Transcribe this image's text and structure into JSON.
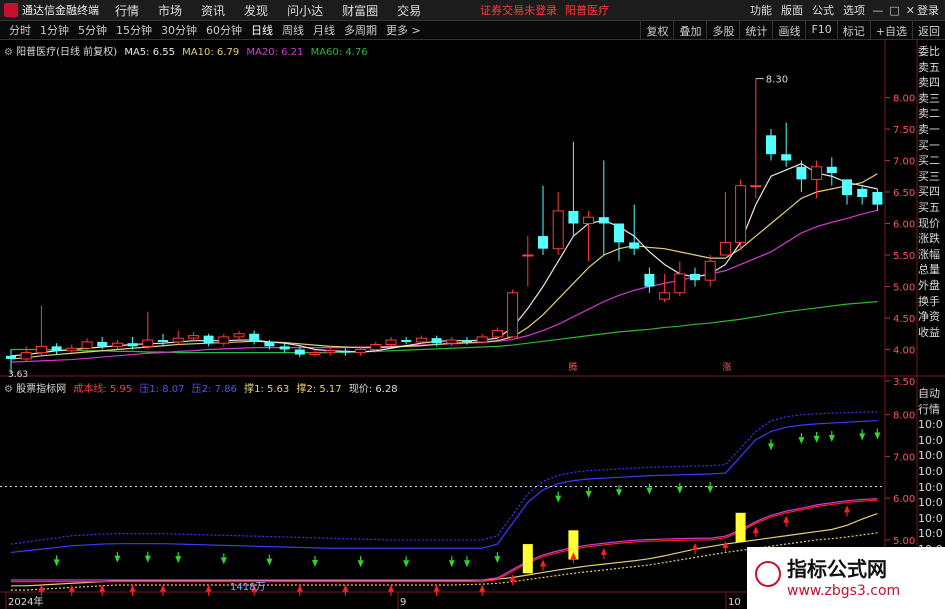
{
  "app": {
    "title": "通达信金融终端"
  },
  "menu": [
    "行情",
    "市场",
    "资讯",
    "发现",
    "问小达",
    "财富圈",
    "交易"
  ],
  "status": {
    "login_state": "证券交易未登录",
    "stock_name": "阳普医疗"
  },
  "right_links": [
    "功能",
    "版面",
    "公式",
    "选项"
  ],
  "login_label": "登录",
  "periods": [
    "分时",
    "1分钟",
    "5分钟",
    "15分钟",
    "30分钟",
    "60分钟",
    "日线",
    "周线",
    "月线",
    "多周期",
    "更多"
  ],
  "active_period": "日线",
  "tool_buttons": [
    "复权",
    "叠加",
    "多股",
    "统计",
    "画线",
    "F10",
    "标记",
    "+自选",
    "返回"
  ],
  "main_legend": {
    "title": "阳普医疗(日线 前复权)",
    "ma5": "MA5: 6.55",
    "ma10": "MA10: 6.79",
    "ma20": "MA20: 6.21",
    "ma60": "MA60: 4.76"
  },
  "ind_legend": {
    "title": "股票指标网",
    "cost": "成本线: 5.95",
    "z1": "压1: 8.07",
    "z2": "压2: 7.86",
    "s1": "撑1: 5.63",
    "s2": "撑2: 5.17",
    "price": "现价: 6.28"
  },
  "price_axis_top": [
    "8.00",
    "7.50",
    "7.00",
    "6.50",
    "6.00",
    "5.50",
    "5.00",
    "4.50",
    "4.00",
    "3.50"
  ],
  "price_axis_bottom": [
    "8.00",
    "7.00",
    "6.00",
    "5.00"
  ],
  "right_panel_top": [
    "委比",
    "卖五",
    "卖四",
    "卖三",
    "卖二",
    "卖一",
    "买一",
    "买二",
    "买三",
    "买四",
    "买五",
    "现价",
    "涨跌",
    "涨幅",
    "总量",
    "外盘",
    "换手",
    "净资",
    "收益"
  ],
  "right_panel_bottom": [
    "自动",
    "行情",
    "10:0",
    "10:0",
    "10:0",
    "10:0",
    "10:0",
    "10:0",
    "10:0",
    "10:0",
    "10:0",
    "10:0"
  ],
  "annotations": {
    "high": "8.30",
    "low": "3.63",
    "marker_a": "腾",
    "marker_b": "涨",
    "volume": "1418万"
  },
  "date_axis": [
    "2024年",
    "9",
    "10"
  ],
  "watermark": {
    "line1": "指标公式网",
    "line2": "www.zbgs3.com"
  },
  "colors": {
    "up": "#ff3b3b",
    "down": "#54ffff",
    "ma5": "#e8e8e8",
    "ma10": "#e6d07a",
    "ma20": "#d23ad2",
    "ma60": "#2fb82f",
    "cost": "#ff2020",
    "press1": "#3a3aff",
    "support": "#e6d07a",
    "bar": "#ffff33"
  },
  "chart_data": {
    "type": "candlestick",
    "candles": [
      [
        3.9,
        3.85,
        4.0,
        3.63
      ],
      [
        3.85,
        3.95,
        4.05,
        3.8
      ],
      [
        3.95,
        4.05,
        4.7,
        3.9
      ],
      [
        4.05,
        3.98,
        4.1,
        3.92
      ],
      [
        3.98,
        4.02,
        4.08,
        3.94
      ],
      [
        4.02,
        4.12,
        4.18,
        3.98
      ],
      [
        4.12,
        4.05,
        4.2,
        4.0
      ],
      [
        4.05,
        4.1,
        4.15,
        4.0
      ],
      [
        4.1,
        4.05,
        4.2,
        4.0
      ],
      [
        4.05,
        4.15,
        4.6,
        4.0
      ],
      [
        4.15,
        4.12,
        4.25,
        4.05
      ],
      [
        4.12,
        4.18,
        4.3,
        4.08
      ],
      [
        4.18,
        4.22,
        4.28,
        4.12
      ],
      [
        4.22,
        4.1,
        4.25,
        4.05
      ],
      [
        4.1,
        4.2,
        4.25,
        4.05
      ],
      [
        4.2,
        4.25,
        4.3,
        4.15
      ],
      [
        4.25,
        4.12,
        4.3,
        4.08
      ],
      [
        4.12,
        4.05,
        4.15,
        4.0
      ],
      [
        4.05,
        4.0,
        4.1,
        3.95
      ],
      [
        4.0,
        3.92,
        4.05,
        3.88
      ],
      [
        3.92,
        3.95,
        4.0,
        3.88
      ],
      [
        3.95,
        3.98,
        4.05,
        3.9
      ],
      [
        3.98,
        3.95,
        4.02,
        3.9
      ],
      [
        3.95,
        4.0,
        4.05,
        3.9
      ],
      [
        4.0,
        4.08,
        4.12,
        3.95
      ],
      [
        4.08,
        4.15,
        4.2,
        4.05
      ],
      [
        4.15,
        4.12,
        4.2,
        4.08
      ],
      [
        4.12,
        4.18,
        4.22,
        4.1
      ],
      [
        4.18,
        4.1,
        4.22,
        4.05
      ],
      [
        4.1,
        4.15,
        4.2,
        4.05
      ],
      [
        4.15,
        4.12,
        4.2,
        4.08
      ],
      [
        4.12,
        4.2,
        4.25,
        4.1
      ],
      [
        4.2,
        4.3,
        4.35,
        4.15
      ],
      [
        4.2,
        4.9,
        4.95,
        4.2
      ],
      [
        5.5,
        5.5,
        5.8,
        5.0
      ],
      [
        5.8,
        5.6,
        6.6,
        5.5
      ],
      [
        5.6,
        6.2,
        6.5,
        5.5
      ],
      [
        6.2,
        6.0,
        7.3,
        5.8
      ],
      [
        6.0,
        6.1,
        6.2,
        5.4
      ],
      [
        6.1,
        6.0,
        7.0,
        5.5
      ],
      [
        6.0,
        5.7,
        5.9,
        5.4
      ],
      [
        5.7,
        5.6,
        6.3,
        5.5
      ],
      [
        5.2,
        5.0,
        5.3,
        4.9
      ],
      [
        4.8,
        4.9,
        5.2,
        4.75
      ],
      [
        4.9,
        5.2,
        5.4,
        4.85
      ],
      [
        5.2,
        5.1,
        5.3,
        5.0
      ],
      [
        5.1,
        5.4,
        5.5,
        5.0
      ],
      [
        5.5,
        5.7,
        6.5,
        5.5
      ],
      [
        5.7,
        6.6,
        6.7,
        5.6
      ],
      [
        6.6,
        6.6,
        8.3,
        6.4
      ],
      [
        7.4,
        7.1,
        7.5,
        7.0
      ],
      [
        7.1,
        7.0,
        7.6,
        6.9
      ],
      [
        6.9,
        6.7,
        7.0,
        6.5
      ],
      [
        6.7,
        6.9,
        7.0,
        6.4
      ],
      [
        6.9,
        6.8,
        7.05,
        6.6
      ],
      [
        6.7,
        6.45,
        6.6,
        6.3
      ],
      [
        6.55,
        6.42,
        6.6,
        6.3
      ],
      [
        6.5,
        6.3,
        6.55,
        6.2
      ]
    ],
    "ma5": [
      3.9,
      3.92,
      3.95,
      3.98,
      4.0,
      4.02,
      4.04,
      4.06,
      4.08,
      4.09,
      4.1,
      4.12,
      4.14,
      4.14,
      4.14,
      4.15,
      4.15,
      4.12,
      4.1,
      4.06,
      4.0,
      3.98,
      3.97,
      3.96,
      3.98,
      4.02,
      4.06,
      4.1,
      4.13,
      4.14,
      4.14,
      4.15,
      4.18,
      4.35,
      4.65,
      5.0,
      5.4,
      5.8,
      6.0,
      6.05,
      5.95,
      5.8,
      5.55,
      5.35,
      5.2,
      5.15,
      5.2,
      5.35,
      5.7,
      6.3,
      6.75,
      6.85,
      6.95,
      6.8,
      6.75,
      6.65,
      6.6,
      6.55
    ],
    "ma10": [
      3.85,
      3.87,
      3.9,
      3.92,
      3.94,
      3.96,
      3.98,
      4.0,
      4.02,
      4.04,
      4.06,
      4.08,
      4.09,
      4.1,
      4.11,
      4.12,
      4.13,
      4.12,
      4.11,
      4.09,
      4.07,
      4.05,
      4.04,
      4.03,
      4.03,
      4.04,
      4.05,
      4.06,
      4.08,
      4.1,
      4.11,
      4.12,
      4.14,
      4.2,
      4.35,
      4.55,
      4.8,
      5.05,
      5.3,
      5.5,
      5.6,
      5.65,
      5.62,
      5.6,
      5.55,
      5.5,
      5.45,
      5.45,
      5.6,
      5.8,
      6.0,
      6.2,
      6.4,
      6.5,
      6.55,
      6.6,
      6.65,
      6.79
    ],
    "ma20": [
      3.8,
      3.81,
      3.82,
      3.83,
      3.84,
      3.86,
      3.88,
      3.9,
      3.92,
      3.94,
      3.95,
      3.97,
      3.98,
      4.0,
      4.01,
      4.02,
      4.03,
      4.03,
      4.03,
      4.03,
      4.03,
      4.03,
      4.03,
      4.04,
      4.04,
      4.05,
      4.06,
      4.07,
      4.08,
      4.09,
      4.1,
      4.11,
      4.13,
      4.16,
      4.22,
      4.3,
      4.4,
      4.52,
      4.64,
      4.76,
      4.86,
      4.94,
      5.0,
      5.05,
      5.1,
      5.15,
      5.2,
      5.25,
      5.35,
      5.45,
      5.55,
      5.7,
      5.85,
      5.95,
      6.02,
      6.08,
      6.15,
      6.21
    ],
    "ma60": [
      4.0,
      4.0,
      4.0,
      3.99,
      3.99,
      3.98,
      3.98,
      3.97,
      3.97,
      3.96,
      3.96,
      3.95,
      3.95,
      3.95,
      3.95,
      3.95,
      3.95,
      3.95,
      3.95,
      3.95,
      3.95,
      3.95,
      3.96,
      3.96,
      3.97,
      3.98,
      3.99,
      4.0,
      4.01,
      4.02,
      4.03,
      4.04,
      4.05,
      4.07,
      4.1,
      4.13,
      4.16,
      4.19,
      4.22,
      4.25,
      4.28,
      4.3,
      4.32,
      4.35,
      4.37,
      4.4,
      4.42,
      4.45,
      4.48,
      4.52,
      4.56,
      4.6,
      4.63,
      4.66,
      4.69,
      4.72,
      4.74,
      4.76
    ],
    "ind_cost": [
      4.0,
      4.0,
      4.0,
      4.0,
      4.0,
      4.0,
      4.0,
      4.0,
      4.0,
      4.0,
      4.0,
      4.0,
      4.0,
      4.0,
      4.0,
      4.0,
      4.0,
      4.0,
      4.0,
      4.0,
      4.0,
      4.0,
      4.0,
      4.0,
      4.0,
      4.0,
      4.0,
      4.0,
      4.0,
      4.0,
      4.0,
      4.0,
      4.05,
      4.25,
      4.45,
      4.6,
      4.7,
      4.78,
      4.84,
      4.88,
      4.92,
      4.95,
      4.97,
      4.98,
      4.99,
      5.0,
      5.0,
      5.05,
      5.2,
      5.4,
      5.55,
      5.65,
      5.72,
      5.8,
      5.85,
      5.9,
      5.93,
      5.95
    ],
    "ind_press1": [
      4.9,
      4.95,
      5.0,
      5.05,
      5.1,
      5.12,
      5.14,
      5.15,
      5.15,
      5.15,
      5.15,
      5.14,
      5.13,
      5.12,
      5.11,
      5.1,
      5.09,
      5.08,
      5.07,
      5.06,
      5.05,
      5.04,
      5.03,
      5.02,
      5.01,
      5.0,
      5.0,
      5.0,
      5.0,
      5.0,
      5.0,
      5.0,
      5.1,
      5.6,
      6.1,
      6.4,
      6.55,
      6.62,
      6.66,
      6.68,
      6.7,
      6.72,
      6.74,
      6.75,
      6.76,
      6.77,
      6.78,
      6.8,
      7.2,
      7.6,
      7.85,
      7.95,
      8.0,
      8.02,
      8.04,
      8.05,
      8.06,
      8.07
    ],
    "ind_press2": [
      4.7,
      4.74,
      4.78,
      4.82,
      4.86,
      4.88,
      4.9,
      4.91,
      4.91,
      4.91,
      4.91,
      4.9,
      4.89,
      4.88,
      4.87,
      4.86,
      4.85,
      4.84,
      4.83,
      4.82,
      4.81,
      4.8,
      4.8,
      4.8,
      4.8,
      4.8,
      4.8,
      4.8,
      4.8,
      4.8,
      4.8,
      4.8,
      4.9,
      5.4,
      5.9,
      6.2,
      6.35,
      6.42,
      6.46,
      6.48,
      6.5,
      6.52,
      6.54,
      6.55,
      6.56,
      6.57,
      6.58,
      6.6,
      7.0,
      7.4,
      7.6,
      7.7,
      7.75,
      7.78,
      7.8,
      7.82,
      7.84,
      7.86
    ],
    "ind_support1": [
      3.9,
      3.9,
      3.92,
      3.94,
      3.96,
      3.98,
      4.0,
      4.02,
      4.02,
      4.02,
      4.02,
      4.02,
      4.02,
      4.02,
      4.02,
      4.02,
      4.02,
      4.02,
      4.02,
      4.02,
      4.02,
      4.02,
      4.02,
      4.02,
      4.02,
      4.02,
      4.02,
      4.02,
      4.02,
      4.02,
      4.03,
      4.04,
      4.06,
      4.1,
      4.16,
      4.22,
      4.28,
      4.33,
      4.38,
      4.42,
      4.46,
      4.5,
      4.55,
      4.62,
      4.7,
      4.78,
      4.84,
      4.9,
      4.95,
      5.0,
      5.05,
      5.1,
      5.15,
      5.2,
      5.25,
      5.35,
      5.5,
      5.63
    ],
    "ind_support2": [
      3.8,
      3.8,
      3.82,
      3.84,
      3.86,
      3.88,
      3.9,
      3.92,
      3.92,
      3.92,
      3.92,
      3.92,
      3.92,
      3.92,
      3.92,
      3.92,
      3.92,
      3.92,
      3.92,
      3.92,
      3.92,
      3.92,
      3.92,
      3.92,
      3.92,
      3.92,
      3.92,
      3.92,
      3.92,
      3.92,
      3.93,
      3.94,
      3.96,
      4.0,
      4.05,
      4.1,
      4.15,
      4.2,
      4.24,
      4.28,
      4.32,
      4.36,
      4.4,
      4.46,
      4.52,
      4.58,
      4.64,
      4.7,
      4.75,
      4.8,
      4.85,
      4.9,
      4.95,
      5.0,
      5.03,
      5.07,
      5.12,
      5.17
    ],
    "ind_price_line": 6.28,
    "ind_bars": [
      34,
      37,
      48
    ],
    "ind_bar_range": [
      4.25,
      4.7
    ],
    "ind_up_arrows": [
      2,
      4,
      6,
      8,
      10,
      13,
      16,
      19,
      22,
      25,
      28,
      31,
      33,
      35,
      37,
      39,
      45,
      47,
      49,
      51,
      55
    ],
    "ind_down_arrows": [
      3,
      7,
      9,
      11,
      14,
      17,
      20,
      23,
      26,
      29,
      30,
      32,
      36,
      38,
      40,
      42,
      44,
      46,
      50,
      52,
      53,
      54,
      56,
      57
    ]
  }
}
